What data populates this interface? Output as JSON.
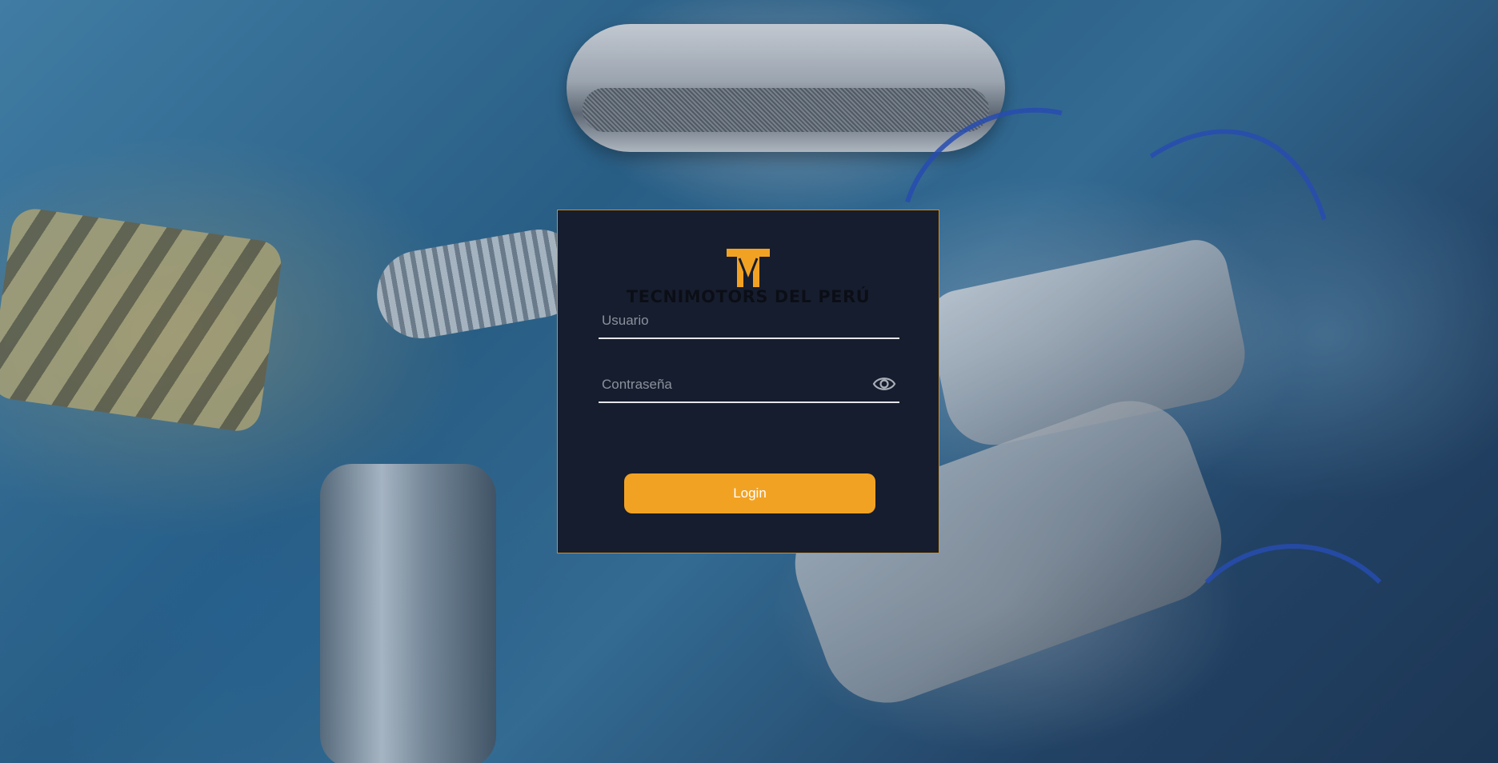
{
  "brand": {
    "name": "TECNIMOTORS DEL PERÚ",
    "logo_icon": "tm-logo-icon",
    "logo_color": "#f2a223"
  },
  "form": {
    "username_placeholder": "Usuario",
    "username_value": "",
    "password_placeholder": "Contraseña",
    "password_value": "",
    "toggle_icon": "eye-icon",
    "login_label": "Login"
  },
  "colors": {
    "card_background": "#161d2e",
    "card_border": "#c8902a",
    "accent": "#f2a223",
    "field_line": "#e4e6ea"
  }
}
